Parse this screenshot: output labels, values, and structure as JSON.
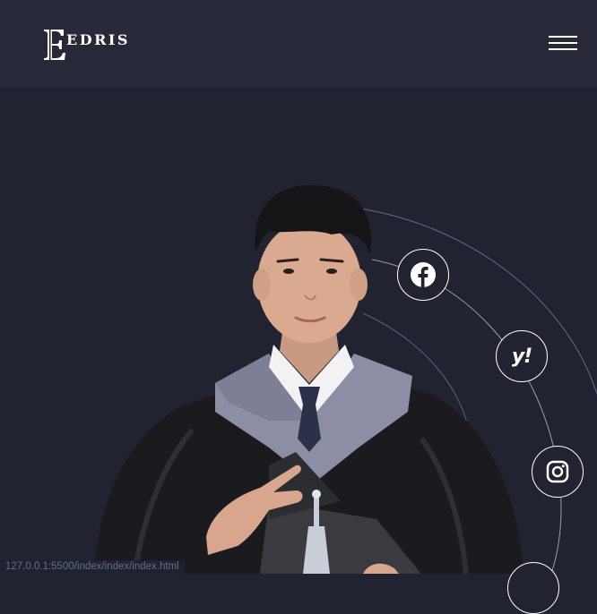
{
  "header": {
    "logo_text": "EDRIS",
    "logo_icon": "serif-e-monogram",
    "menu_icon": "hamburger-icon"
  },
  "hero": {
    "photo_subject": "graduate-portrait",
    "socials": [
      {
        "name": "facebook",
        "icon": "facebook-icon"
      },
      {
        "name": "yahoo",
        "icon": "yahoo-icon",
        "glyph": "y!"
      },
      {
        "name": "instagram",
        "icon": "instagram-icon"
      },
      {
        "name": "partial",
        "icon": "social-icon"
      }
    ]
  },
  "status_bar": {
    "url": "127.0.0.1:5500/index/index/index.html"
  },
  "colors": {
    "background": "#222330",
    "header": "#272938",
    "accent": "#ffffff",
    "gown": "#1b1b1e",
    "hood": "#8d8fa6"
  }
}
